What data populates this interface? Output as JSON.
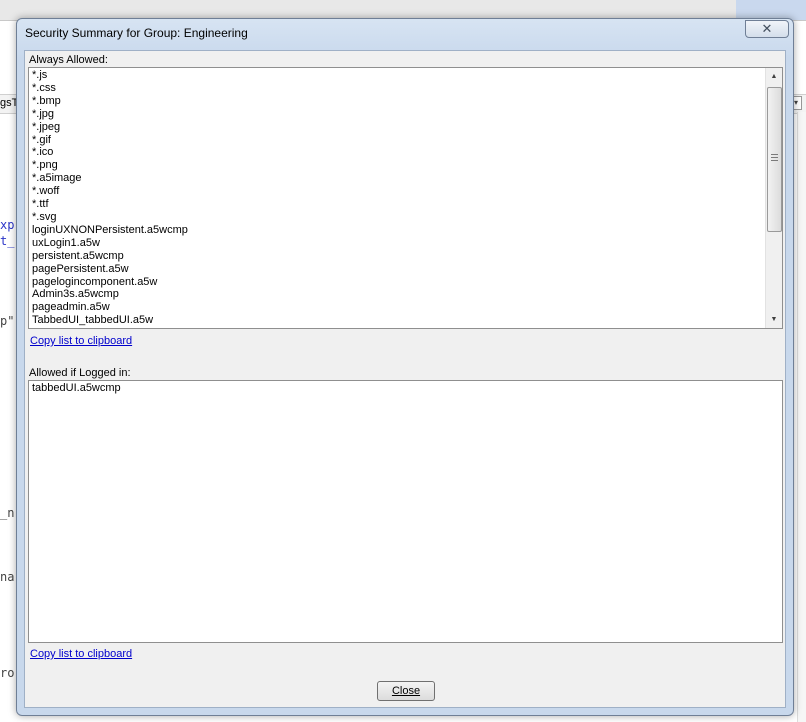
{
  "dialog": {
    "title": "Security Summary for Group: Engineering",
    "close_glyph": "✕"
  },
  "always_allowed": {
    "label": "Always Allowed:",
    "items": [
      "*.js",
      "*.css",
      "*.bmp",
      "*.jpg",
      "*.jpeg",
      "*.gif",
      "*.ico",
      "*.png",
      "*.a5image",
      "*.woff",
      "*.ttf",
      "*.svg",
      "loginUXNONPersistent.a5wcmp",
      "uxLogin1.a5w",
      "persistent.a5wcmp",
      "pagePersistent.a5w",
      "pagelogincomponent.a5w",
      "Admin3s.a5wcmp",
      "pageadmin.a5w",
      "TabbedUI_tabbedUI.a5w"
    ],
    "copy_link": "Copy list to clipboard"
  },
  "allowed_if_logged_in": {
    "label": "Allowed if Logged in:",
    "items": [
      "tabbedUI.a5wcmp"
    ],
    "copy_link": "Copy list to clipboard"
  },
  "footer": {
    "close_label": "Close"
  },
  "background": {
    "tab_fragment": "gsT",
    "code_fragments": [
      "xp",
      "t_",
      "p\"",
      "_n",
      "na",
      "ro"
    ]
  },
  "icons": {
    "scroll_up": "▲",
    "scroll_down": "▼",
    "dropdown": "▾"
  }
}
